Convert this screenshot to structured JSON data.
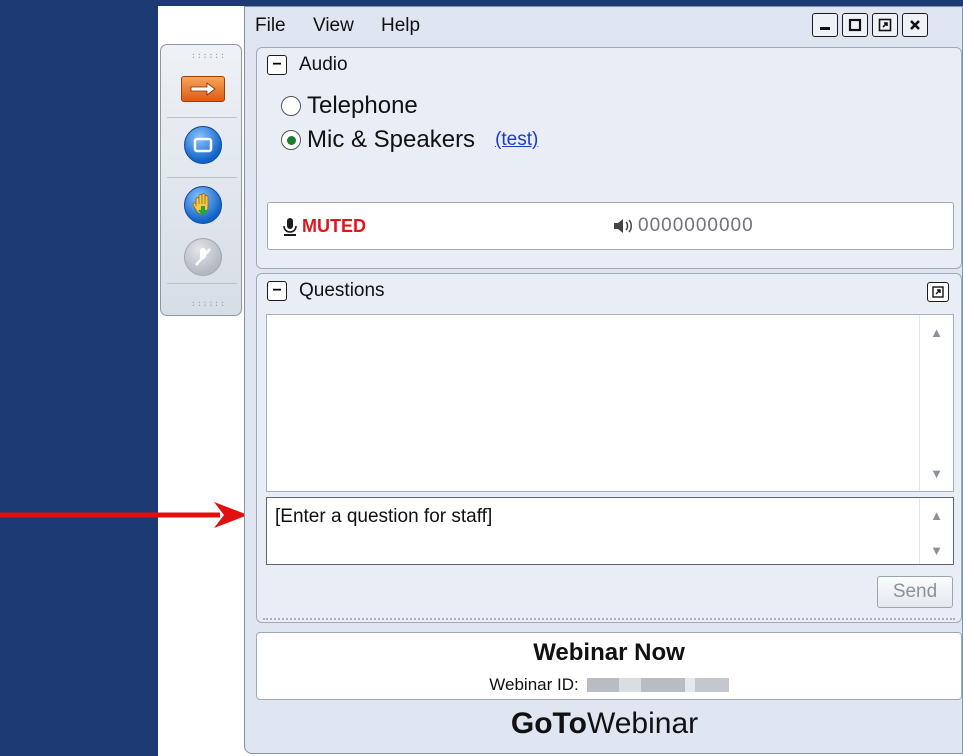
{
  "menu": {
    "file": "File",
    "view": "View",
    "help": "Help"
  },
  "window_controls": [
    "minimize-icon",
    "restore-icon",
    "popout-icon",
    "close-icon"
  ],
  "audio": {
    "title": "Audio",
    "options": [
      {
        "label": "Telephone",
        "selected": false
      },
      {
        "label": "Mic & Speakers",
        "selected": true
      }
    ],
    "test_link": "(test)",
    "mic_status": "MUTED",
    "speaker_level": "0000000000"
  },
  "questions": {
    "title": "Questions",
    "input_placeholder": "[Enter a question for staff]",
    "send_label": "Send"
  },
  "webinar": {
    "title": "Webinar Now",
    "id_label": "Webinar ID:"
  },
  "brand": {
    "bold": "GoTo",
    "regular": "Webinar"
  },
  "colors": {
    "background_blue": "#1e3a74",
    "arrow_red": "#e01010",
    "muted_red": "#e0161c",
    "link_blue": "#1a3cc8",
    "radio_green": "#1a7f2c"
  }
}
